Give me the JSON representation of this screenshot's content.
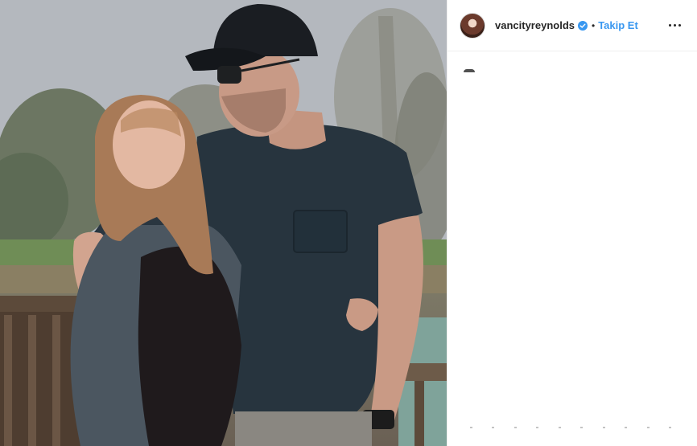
{
  "post": {
    "photo_alt": "",
    "header": {
      "username": "vancityreynolds",
      "verified": true,
      "separator": "•",
      "follow_label": "Takip Et",
      "more_icon": "more-options-icon"
    }
  },
  "colors": {
    "follow_blue": "#3897f0",
    "verified_blue": "#3897f0",
    "text": "#262626",
    "divider": "#efefef"
  }
}
